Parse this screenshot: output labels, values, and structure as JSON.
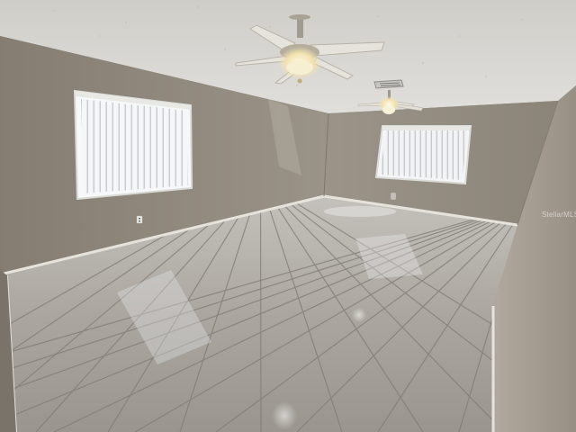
{
  "watermark": {
    "text": "StellarMLS"
  },
  "colors": {
    "ceiling": "#d7d6d2",
    "left_wall": "#8d857a",
    "back_wall": "#948d82",
    "right_wall": "#a39a8f",
    "floor_tile": "#aaa59e",
    "grout": "#7f7a73",
    "baseboard": "#e6e3dd",
    "window_blinds": "#f3f5f7"
  },
  "icons": [
    "ceiling-fan-icon",
    "ceiling-fan-icon",
    "hvac-vent-icon",
    "outlet-icon"
  ]
}
